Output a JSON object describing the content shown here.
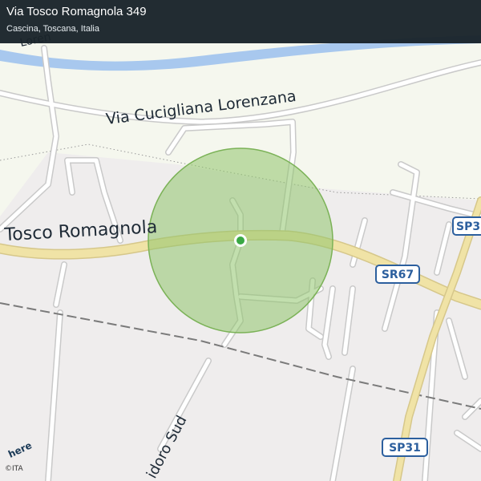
{
  "header": {
    "title": "Via Tosco Romagnola 349",
    "subtitle": "Cascina, Toscana, Italia"
  },
  "map": {
    "colors": {
      "background": "#f5f7ee",
      "builtup": "#efeded",
      "river": "#a8c8ee",
      "main_road": "#f0e3a6",
      "road": "#ffffff",
      "road_casing": "#c9c9c9",
      "railway": "#7a7a7a",
      "accuracy_circle": "#8fc46b",
      "marker": "#3aa845",
      "shield_border": "#2c5f9e"
    },
    "street_labels": {
      "tosco_romagnola": "Tosco Romagnola",
      "cucigliana": "Via Cucigliana Lorenzana",
      "isidoro_sud": "idoro Sud",
      "top_partial": "Loren"
    },
    "shields": {
      "sr67": "SR67",
      "sp31": "SP31",
      "sp3_partial": "SP3"
    },
    "location_marker": "current-location-marker"
  },
  "branding": {
    "logo_text": "here",
    "copyright": "©ITA"
  }
}
